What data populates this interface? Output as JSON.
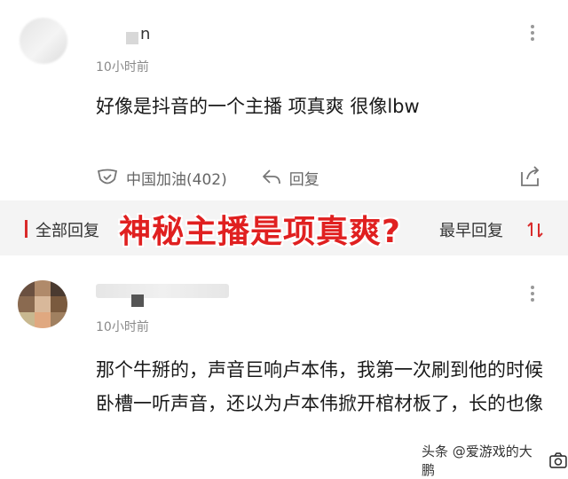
{
  "comment1": {
    "username": "n",
    "time": "10小时前",
    "text": "好像是抖音的一个主播 项真爽 很像lbw",
    "like_label": "中国加油(402)",
    "reply_label": "回复"
  },
  "sort_bar": {
    "all_replies": "全部回复",
    "earliest": "最早回复"
  },
  "overlay_title": "神秘主播是项真爽?",
  "comment2": {
    "time": "10小时前",
    "text": "那个牛掰的，声音巨响卢本伟，我第一次刷到他的时候卧槽一听声音，还以为卢本伟掀开棺材板了，长的也像"
  },
  "watermark": "头条 @爱游戏的大鹏",
  "icons": [
    "like-icon",
    "reply-icon",
    "share-icon",
    "more-icon",
    "sort-icon",
    "camera-icon"
  ],
  "colors": {
    "accent_red": "#e02020",
    "band_bg": "#f4f4f4",
    "muted": "#8a8a8a"
  }
}
